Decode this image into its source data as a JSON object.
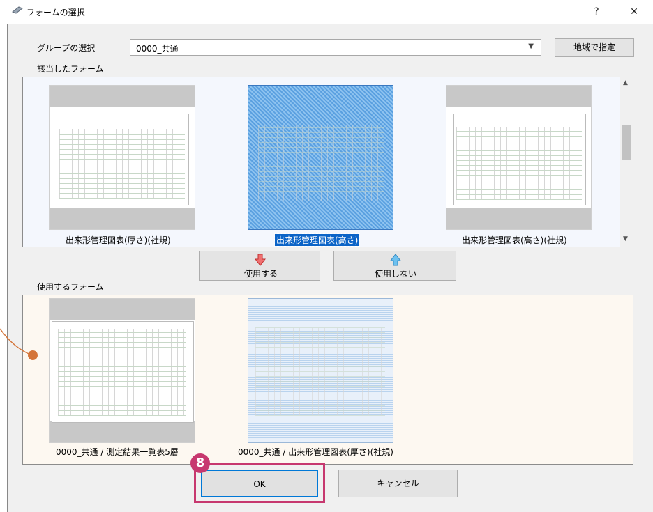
{
  "window": {
    "title": "フォームの選択",
    "help_label": "?",
    "close_label": "✕"
  },
  "group": {
    "label": "グループの選択",
    "selected": "0000_共通",
    "region_button": "地域で指定"
  },
  "available": {
    "label": "該当したフォーム",
    "items": [
      {
        "caption": "出来形管理図表(厚さ)(社規)"
      },
      {
        "caption": "出来形管理図表(高さ)"
      },
      {
        "caption": "出来形管理図表(高さ)(社規)"
      }
    ]
  },
  "actions": {
    "use_label": "使用する",
    "unuse_label": "使用しない"
  },
  "used": {
    "label": "使用するフォーム",
    "items": [
      {
        "caption": "0000_共通 / 測定結果一覧表5層"
      },
      {
        "caption": "0000_共通 / 出来形管理図表(厚さ)(社規)"
      }
    ]
  },
  "footer": {
    "ok_label": "OK",
    "cancel_label": "キャンセル"
  },
  "annotation": {
    "step": "8"
  },
  "colors": {
    "accent": "#c7386f",
    "selection": "#0a63c7",
    "marker": "#d4753a"
  }
}
